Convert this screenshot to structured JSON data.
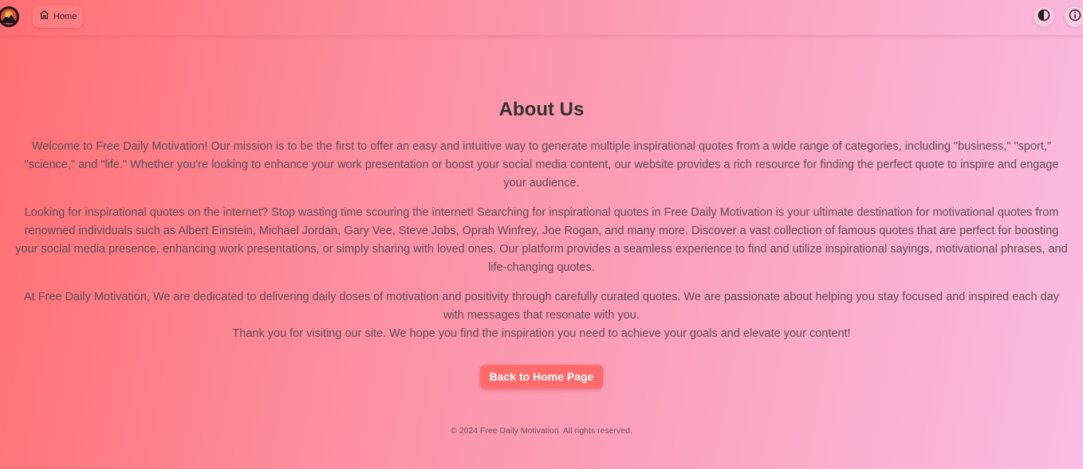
{
  "nav": {
    "home_label": "Home",
    "icons": {
      "logo": "mountain-sunset-logo",
      "home": "home-icon",
      "theme": "contrast-icon",
      "info": "info-icon"
    }
  },
  "main": {
    "title": "About Us",
    "paragraphs": [
      "Welcome to Free Daily Motivation! Our mission is to be the first to offer an easy and intuitive way to generate multiple inspirational quotes from a wide range of categories, including \"business,\" \"sport,\" \"science,\" and \"life.\" Whether you're looking to enhance your work presentation or boost your social media content, our website provides a rich resource for finding the perfect quote to inspire and engage your audience.",
      "Looking for inspirational quotes on the internet? Stop wasting time scouring the internet! Searching for inspirational quotes in Free Daily Motivation is your ultimate destination for motivational quotes from renowned individuals such as Albert Einstein, Michael Jordan, Gary Vee, Steve Jobs, Oprah Winfrey, Joe Rogan, and many more. Discover a vast collection of famous quotes that are perfect for boosting your social media presence, enhancing work presentations, or simply sharing with loved ones. Our platform provides a seamless experience to find and utilize inspirational sayings, motivational phrases, and life-changing quotes.",
      "At Free Daily Motivation, We are dedicated to delivering daily doses of motivation and positivity through carefully curated quotes. We are passionate about helping you stay focused and inspired each day with messages that resonate with you.",
      "Thank you for visiting our site. We hope you find the inspiration you need to achieve your goals and elevate your content!"
    ],
    "back_button_label": "Back to Home Page"
  },
  "footer": {
    "text": "© 2024 Free Daily Motivation. All rights reserved."
  },
  "colors": {
    "accent_button": "#ff6b6b",
    "gradient_start": "#ff6e70",
    "gradient_end": "#fabde3"
  }
}
